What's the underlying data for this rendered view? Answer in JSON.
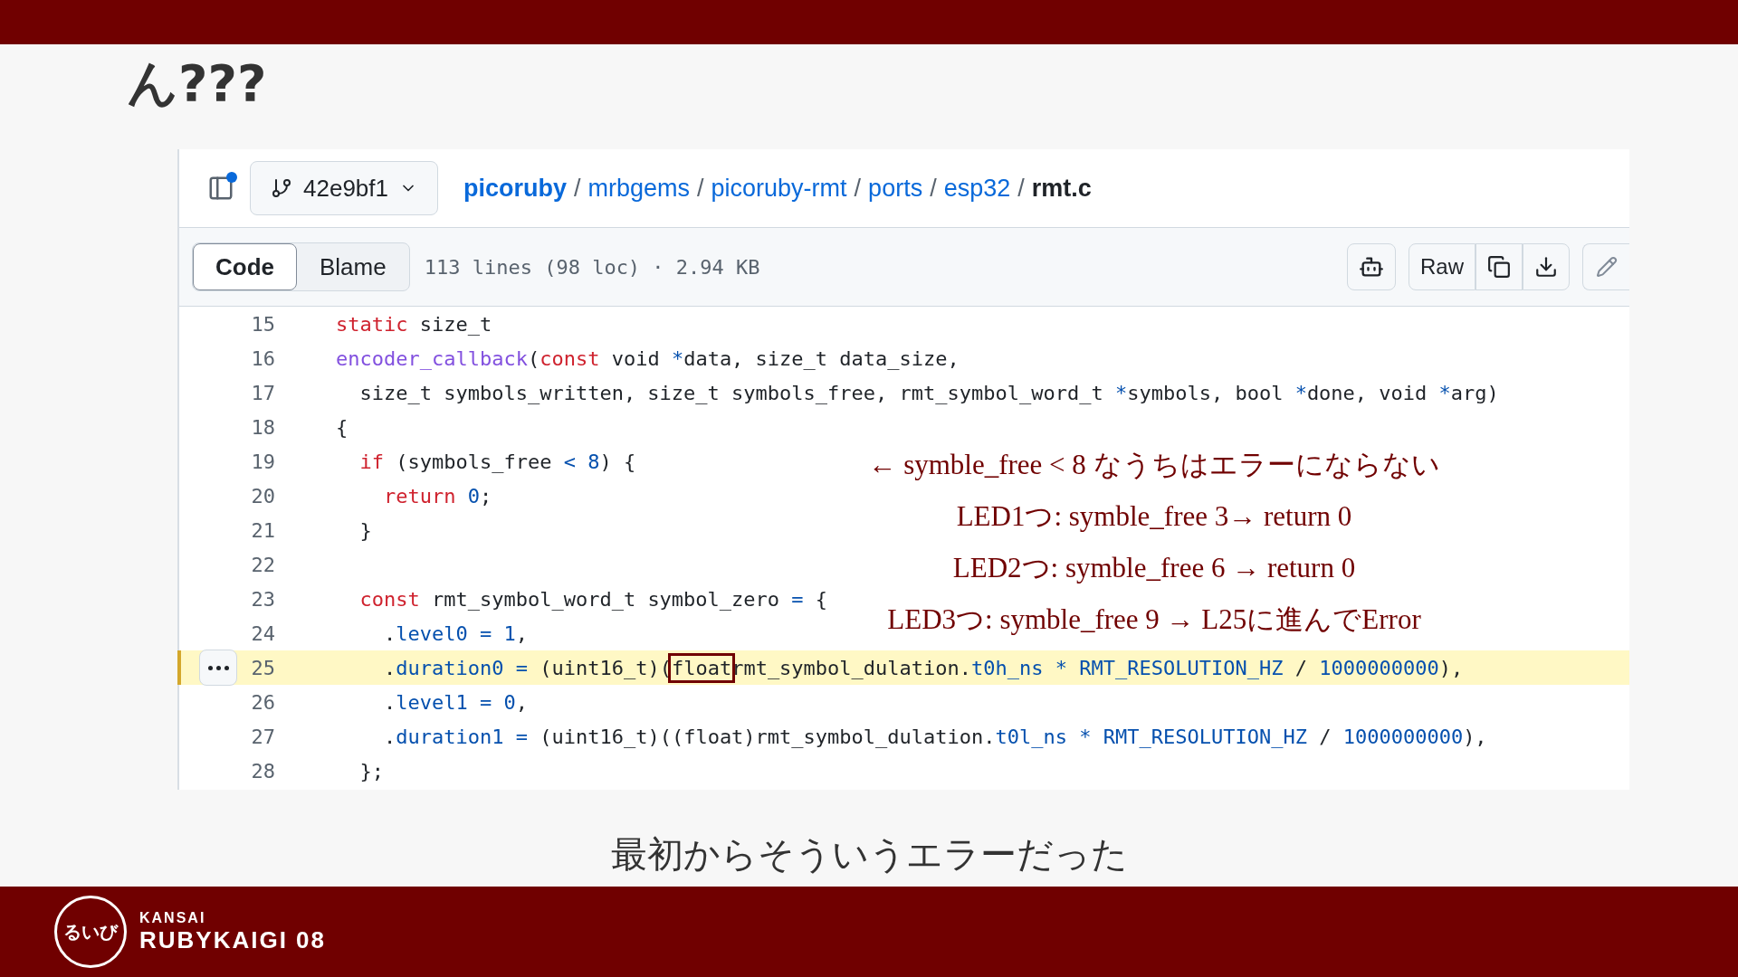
{
  "slide_title": "ん???",
  "file_view": {
    "header": {
      "branch": "42e9bf1",
      "has_notification": true,
      "breadcrumb": [
        {
          "text": "picoruby",
          "kind": "repo"
        },
        {
          "text": "mrbgems",
          "kind": "dir"
        },
        {
          "text": "picoruby-rmt",
          "kind": "dir"
        },
        {
          "text": "ports",
          "kind": "dir"
        },
        {
          "text": "esp32",
          "kind": "dir"
        },
        {
          "text": "rmt.c",
          "kind": "file"
        }
      ],
      "separator": "/"
    },
    "toolbar": {
      "tabs": [
        {
          "label": "Code",
          "selected": true
        },
        {
          "label": "Blame",
          "selected": false
        }
      ],
      "file_info": "113 lines (98 loc) · 2.94 KB",
      "raw_button": "Raw"
    },
    "code_lines": [
      {
        "number": "15",
        "selected": false,
        "tokens": [
          {
            "kind": "kw",
            "text": "static"
          },
          {
            "kind": "plain",
            "text": " size_t"
          }
        ]
      },
      {
        "number": "16",
        "selected": false,
        "tokens": [
          {
            "kind": "fn",
            "text": "encoder_callback"
          },
          {
            "kind": "plain",
            "text": "("
          },
          {
            "kind": "kw",
            "text": "const"
          },
          {
            "kind": "plain",
            "text": " void "
          },
          {
            "kind": "op",
            "text": "*"
          },
          {
            "kind": "plain",
            "text": "data, size_t data_size,"
          }
        ]
      },
      {
        "number": "17",
        "selected": false,
        "tokens": [
          {
            "kind": "plain",
            "text": "  size_t symbols_written, size_t symbols_free, rmt_symbol_word_t "
          },
          {
            "kind": "op",
            "text": "*"
          },
          {
            "kind": "plain",
            "text": "symbols, bool "
          },
          {
            "kind": "op",
            "text": "*"
          },
          {
            "kind": "plain",
            "text": "done, void "
          },
          {
            "kind": "op",
            "text": "*"
          },
          {
            "kind": "plain",
            "text": "arg)"
          }
        ]
      },
      {
        "number": "18",
        "selected": false,
        "tokens": [
          {
            "kind": "plain",
            "text": "{"
          }
        ]
      },
      {
        "number": "19",
        "selected": false,
        "tokens": [
          {
            "kind": "kw",
            "text": "  if"
          },
          {
            "kind": "plain",
            "text": " (symbols_free "
          },
          {
            "kind": "op",
            "text": "<"
          },
          {
            "kind": "num",
            "text": " 8"
          },
          {
            "kind": "plain",
            "text": ") {"
          }
        ]
      },
      {
        "number": "20",
        "selected": false,
        "tokens": [
          {
            "kind": "kw",
            "text": "    return"
          },
          {
            "kind": "num",
            "text": " 0"
          },
          {
            "kind": "plain",
            "text": ";"
          }
        ]
      },
      {
        "number": "21",
        "selected": false,
        "tokens": [
          {
            "kind": "plain",
            "text": "  }"
          }
        ]
      },
      {
        "number": "22",
        "selected": false
      },
      {
        "number": "23",
        "selected": false,
        "tokens": [
          {
            "kind": "kw",
            "text": "  const"
          },
          {
            "kind": "plain",
            "text": " rmt_symbol_word_t symbol_zero "
          },
          {
            "kind": "op",
            "text": "="
          },
          {
            "kind": "plain",
            "text": " {"
          }
        ]
      },
      {
        "number": "24",
        "selected": false,
        "tokens": [
          {
            "kind": "plain",
            "text": "    ."
          },
          {
            "kind": "num",
            "text": "level0"
          },
          {
            "kind": "op",
            "text": " ="
          },
          {
            "kind": "num",
            "text": " 1"
          },
          {
            "kind": "plain",
            "text": ","
          }
        ]
      },
      {
        "number": "25",
        "selected": true,
        "tokens": [
          {
            "kind": "plain",
            "text": "    ."
          },
          {
            "kind": "num",
            "text": "duration0"
          },
          {
            "kind": "op",
            "text": " ="
          },
          {
            "kind": "plain",
            "text": " (uint16_t)("
          },
          {
            "kind": "boxed",
            "text": "float"
          },
          {
            "kind": "plain",
            "text": "rmt_symbol_dulation."
          },
          {
            "kind": "num",
            "text": "t0h_ns"
          },
          {
            "kind": "op",
            "text": " *"
          },
          {
            "kind": "num",
            "text": " RMT_RESOLUTION_HZ"
          },
          {
            "kind": "plain",
            "text": " / "
          },
          {
            "kind": "num",
            "text": "1000000000"
          },
          {
            "kind": "plain",
            "text": "),"
          }
        ]
      },
      {
        "number": "26",
        "selected": false,
        "tokens": [
          {
            "kind": "plain",
            "text": "    ."
          },
          {
            "kind": "num",
            "text": "level1"
          },
          {
            "kind": "op",
            "text": " ="
          },
          {
            "kind": "num",
            "text": " 0"
          },
          {
            "kind": "plain",
            "text": ","
          }
        ]
      },
      {
        "number": "27",
        "selected": false,
        "tokens": [
          {
            "kind": "plain",
            "text": "    ."
          },
          {
            "kind": "num",
            "text": "duration1"
          },
          {
            "kind": "op",
            "text": " ="
          },
          {
            "kind": "plain",
            "text": " (uint16_t)((float)rmt_symbol_dulation."
          },
          {
            "kind": "num",
            "text": "t0l_ns"
          },
          {
            "kind": "op",
            "text": " *"
          },
          {
            "kind": "num",
            "text": " RMT_RESOLUTION_HZ"
          },
          {
            "kind": "plain",
            "text": " / "
          },
          {
            "kind": "num",
            "text": "1000000000"
          },
          {
            "kind": "plain",
            "text": "),"
          }
        ]
      },
      {
        "number": "28",
        "selected": false,
        "tokens": [
          {
            "kind": "plain",
            "text": "  };"
          }
        ]
      }
    ]
  },
  "annotations": [
    "← symble_free < 8 なうちはエラーにならない",
    "LED1つ: symble_free 3→ return 0",
    "LED2つ: symble_free 6 → return 0",
    "LED3つ: symble_free 9 → L25に進んでError"
  ],
  "caption": "最初からそういうエラーだった",
  "footer": {
    "logo_glyphs": "るいび",
    "region": "KANSAI",
    "event": "RUBYKAIGI 08"
  }
}
